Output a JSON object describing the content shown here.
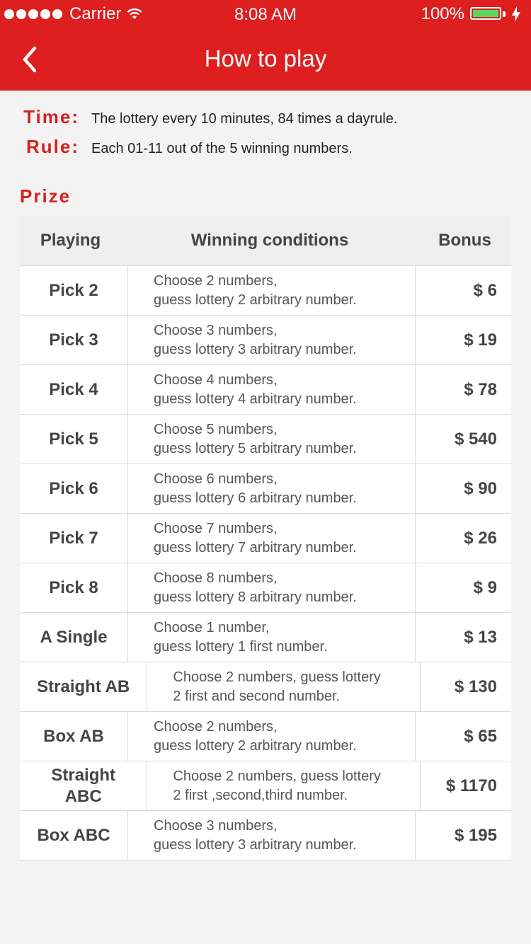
{
  "status_bar": {
    "carrier": "Carrier",
    "time": "8:08 AM",
    "battery": "100%"
  },
  "nav": {
    "title": "How to play"
  },
  "info": {
    "time_label": "Time:",
    "time_text": "The lottery every 10 minutes, 84 times a dayrule.",
    "rule_label": "Rule:",
    "rule_text": "Each 01-11 out of the 5 winning numbers."
  },
  "prize": {
    "heading": "Prize",
    "headers": {
      "playing": "Playing",
      "conditions": "Winning conditions",
      "bonus": "Bonus"
    },
    "rows": [
      {
        "playing": "Pick 2",
        "line1": "Choose 2 numbers,",
        "line2": "guess lottery 2 arbitrary number.",
        "bonus": "$ 6"
      },
      {
        "playing": "Pick 3",
        "line1": "Choose 3 numbers,",
        "line2": "guess lottery 3 arbitrary number.",
        "bonus": "$ 19"
      },
      {
        "playing": "Pick 4",
        "line1": "Choose 4 numbers,",
        "line2": "guess lottery 4 arbitrary number.",
        "bonus": "$ 78"
      },
      {
        "playing": "Pick 5",
        "line1": "Choose 5 numbers,",
        "line2": "guess lottery 5 arbitrary number.",
        "bonus": "$ 540"
      },
      {
        "playing": "Pick 6",
        "line1": "Choose 6 numbers,",
        "line2": "guess lottery 6 arbitrary number.",
        "bonus": "$ 90"
      },
      {
        "playing": "Pick 7",
        "line1": "Choose 7 numbers,",
        "line2": "guess lottery 7 arbitrary number.",
        "bonus": "$ 26"
      },
      {
        "playing": "Pick 8",
        "line1": "Choose 8 numbers,",
        "line2": "guess lottery 8 arbitrary number.",
        "bonus": "$ 9"
      },
      {
        "playing": "A Single",
        "line1": "Choose 1 number,",
        "line2": "guess lottery 1 first number.",
        "bonus": "$ 13"
      },
      {
        "playing": "Straight AB",
        "line1": "Choose 2 numbers, guess lottery",
        "line2": "2 first and second number.",
        "bonus": "$ 130"
      },
      {
        "playing": "Box AB",
        "line1": "Choose 2 numbers,",
        "line2": "guess lottery 2 arbitrary number.",
        "bonus": "$ 65"
      },
      {
        "playing": "Straight ABC",
        "line1": "Choose 2 numbers, guess lottery",
        "line2": "2 first ,second,third number.",
        "bonus": "$ 1170"
      },
      {
        "playing": "Box ABC",
        "line1": "Choose 3 numbers,",
        "line2": "guess lottery 3 arbitrary number.",
        "bonus": "$ 195"
      }
    ]
  },
  "colors": {
    "brand_red": "#dd1f1f",
    "label_red": "#d91f1f",
    "battery_green": "#5cd65c"
  }
}
